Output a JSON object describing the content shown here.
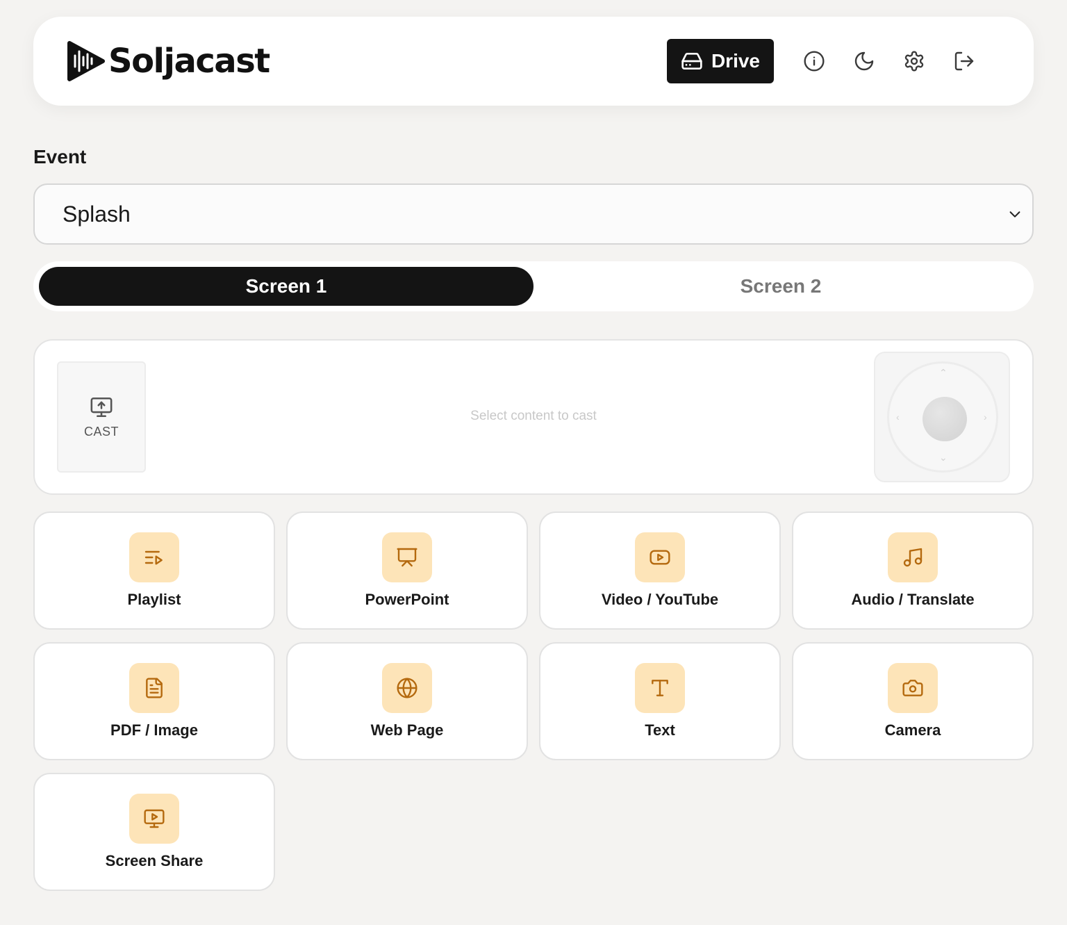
{
  "header": {
    "logo_text": "Soljacast",
    "drive_label": "Drive",
    "icons": [
      "info-icon",
      "moon-icon",
      "gear-icon",
      "logout-icon"
    ]
  },
  "event": {
    "label": "Event",
    "selected": "Splash"
  },
  "tabs": [
    {
      "label": "Screen 1",
      "active": true
    },
    {
      "label": "Screen 2",
      "active": false
    }
  ],
  "cast": {
    "button_label": "CAST",
    "hint": "Select content to cast"
  },
  "tiles": [
    {
      "label": "Playlist",
      "icon": "playlist-icon"
    },
    {
      "label": "PowerPoint",
      "icon": "presentation-icon"
    },
    {
      "label": "Video / YouTube",
      "icon": "video-icon"
    },
    {
      "label": "Audio / Translate",
      "icon": "music-icon"
    },
    {
      "label": "PDF / Image",
      "icon": "document-icon"
    },
    {
      "label": "Web Page",
      "icon": "globe-icon"
    },
    {
      "label": "Text",
      "icon": "text-icon"
    },
    {
      "label": "Camera",
      "icon": "camera-icon"
    },
    {
      "label": "Screen Share",
      "icon": "screen-share-icon"
    }
  ],
  "colors": {
    "accent_dark": "#141414",
    "tile_icon_bg": "#fde4b8",
    "tile_icon_fg": "#b4690e",
    "page_bg": "#f4f3f1"
  }
}
